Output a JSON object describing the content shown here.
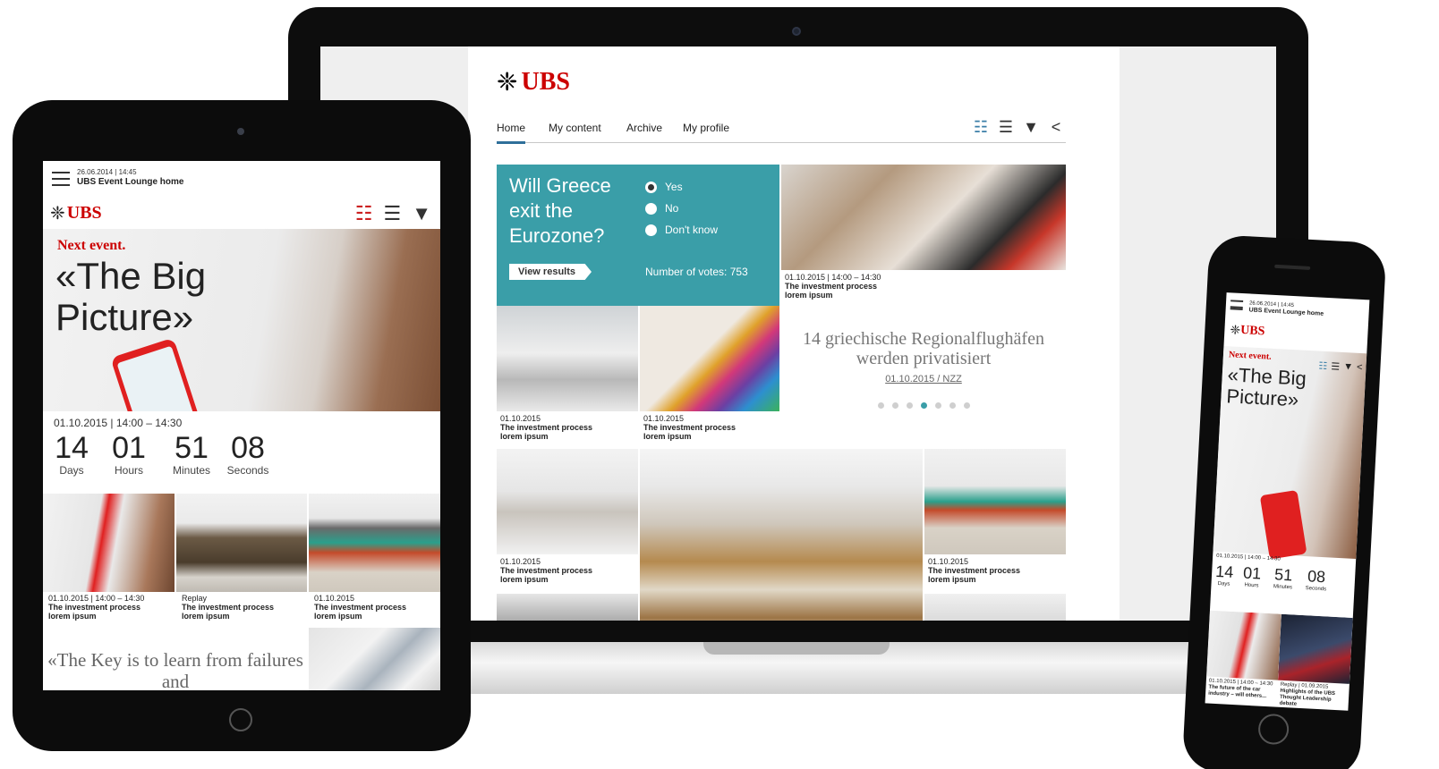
{
  "brand": {
    "name": "UBS",
    "red": "#cc0000",
    "teal": "#3a9ea8"
  },
  "laptop": {
    "nav": {
      "tabs": [
        "Home",
        "My content",
        "Archive",
        "My profile"
      ],
      "active": "Home"
    },
    "tools": [
      "tiles-view-icon",
      "list-view-icon",
      "filter-icon",
      "share-icon"
    ],
    "poll": {
      "question": "Will Greece exit the Eurozone?",
      "options": [
        "Yes",
        "No",
        "Don't know"
      ],
      "selected": "Yes",
      "button": "View results",
      "votes": "Number of votes: 753"
    },
    "tiles": [
      {
        "date": "01.10.2015  |  14:00 – 14:30",
        "title": "The investment process",
        "sub": "lorem ipsum"
      },
      {
        "date": "01.10.2015",
        "title": "The investment process",
        "sub": "lorem ipsum"
      },
      {
        "date": "01.10.2015",
        "title": "The investment process",
        "sub": "lorem ipsum"
      },
      {
        "date": "01.10.2015",
        "title": "The investment process",
        "sub": "lorem ipsum"
      },
      {
        "date": "01.10.2015",
        "title": "The investment process",
        "sub": "lorem ipsum"
      }
    ],
    "news": {
      "headline": "14 griechische Regionalflughäfen werden privatisiert",
      "source": "01.10.2015  /  NZZ",
      "carousel_count": 7,
      "carousel_active": 4
    }
  },
  "tablet": {
    "datetime": "26.06.2014  |  14:45",
    "home": "UBS Event Lounge home",
    "next_label": "Next event.",
    "event_title": "«The Big Picture»",
    "event_when": "01.10.2015  |  14:00 – 14:30",
    "countdown": [
      {
        "value": "14",
        "label": "Days"
      },
      {
        "value": "01",
        "label": "Hours"
      },
      {
        "value": "51",
        "label": "Minutes"
      },
      {
        "value": "08",
        "label": "Seconds"
      }
    ],
    "tiles": [
      {
        "date": "01.10.2015  |  14:00 – 14:30",
        "title": "The investment process",
        "sub": "lorem ipsum"
      },
      {
        "date": "Replay",
        "title": "The investment process",
        "sub": "lorem ipsum"
      },
      {
        "date": "01.10.2015",
        "title": "The investment process",
        "sub": "lorem ipsum"
      }
    ],
    "quote": "«The Key is to learn from failures and"
  },
  "phone": {
    "datetime": "26.06.2014  |  14:45",
    "home": "UBS Event Lounge home",
    "next_label": "Next event.",
    "event_title": "«The Big Picture»",
    "event_when": "01.10.2015  |  14:00 – 14:30",
    "countdown": [
      {
        "value": "14",
        "label": "Days"
      },
      {
        "value": "01",
        "label": "Hours"
      },
      {
        "value": "51",
        "label": "Minutes"
      },
      {
        "value": "08",
        "label": "Seconds"
      }
    ],
    "tiles": [
      {
        "date": "01.10.2015  |  14:00 – 14:30",
        "title": "The future of the car",
        "sub": "industry – will others..."
      },
      {
        "date": "Replay  |  01.09.2015",
        "title": "Highlights of the UBS",
        "sub": "Thought Leadership debate"
      }
    ]
  }
}
